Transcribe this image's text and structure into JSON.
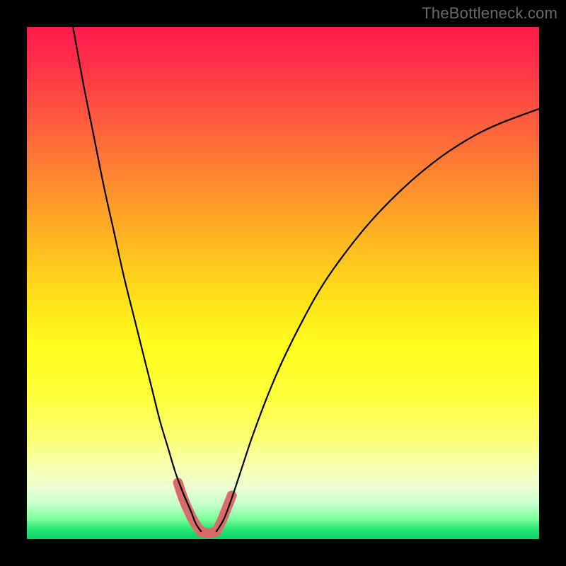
{
  "watermark": "TheBottleneck.com",
  "chart_data": {
    "type": "line",
    "title": "",
    "xlabel": "",
    "ylabel": "",
    "xlim": [
      0,
      100
    ],
    "ylim": [
      0,
      100
    ],
    "grid": false,
    "legend": false,
    "series": [
      {
        "name": "left-curve",
        "x": [
          9,
          11,
          13,
          15,
          17,
          19,
          21,
          23,
          24.5,
          26,
          27.5,
          29,
          30.5,
          32,
          33,
          34
        ],
        "values": [
          100,
          89,
          79,
          69,
          60,
          51,
          43,
          35,
          29,
          23,
          18,
          13,
          9,
          5.5,
          3,
          1.5
        ]
      },
      {
        "name": "right-curve",
        "x": [
          37,
          38.5,
          40,
          42,
          44,
          47,
          50,
          54,
          58,
          63,
          68,
          74,
          80,
          86,
          92,
          100
        ],
        "values": [
          1.5,
          4,
          8,
          14,
          20,
          28,
          35,
          43,
          50,
          57,
          63,
          69,
          74,
          78,
          81,
          84
        ]
      }
    ],
    "highlight_segments": [
      {
        "name": "left-highlight",
        "x": [
          29.5,
          30.5,
          31.8,
          33,
          34
        ],
        "values": [
          11,
          8,
          5,
          2.8,
          1.5
        ]
      },
      {
        "name": "bottom-highlight",
        "x": [
          34,
          35,
          36,
          37
        ],
        "values": [
          1.4,
          1.2,
          1.2,
          1.5
        ]
      },
      {
        "name": "right-highlight",
        "x": [
          37,
          38,
          39,
          40
        ],
        "values": [
          1.5,
          3.5,
          6,
          8.5
        ]
      }
    ],
    "curve_stroke": "#000000",
    "curve_stroke_width": 2.2,
    "highlight_stroke": "#db6a6a",
    "highlight_stroke_width": 14,
    "background_gradient": {
      "top": "#ff1a4d",
      "mid_upper": "#ffb820",
      "mid": "#ffff1f",
      "mid_lower": "#f5ffb0",
      "bottom": "#10cf66"
    }
  }
}
